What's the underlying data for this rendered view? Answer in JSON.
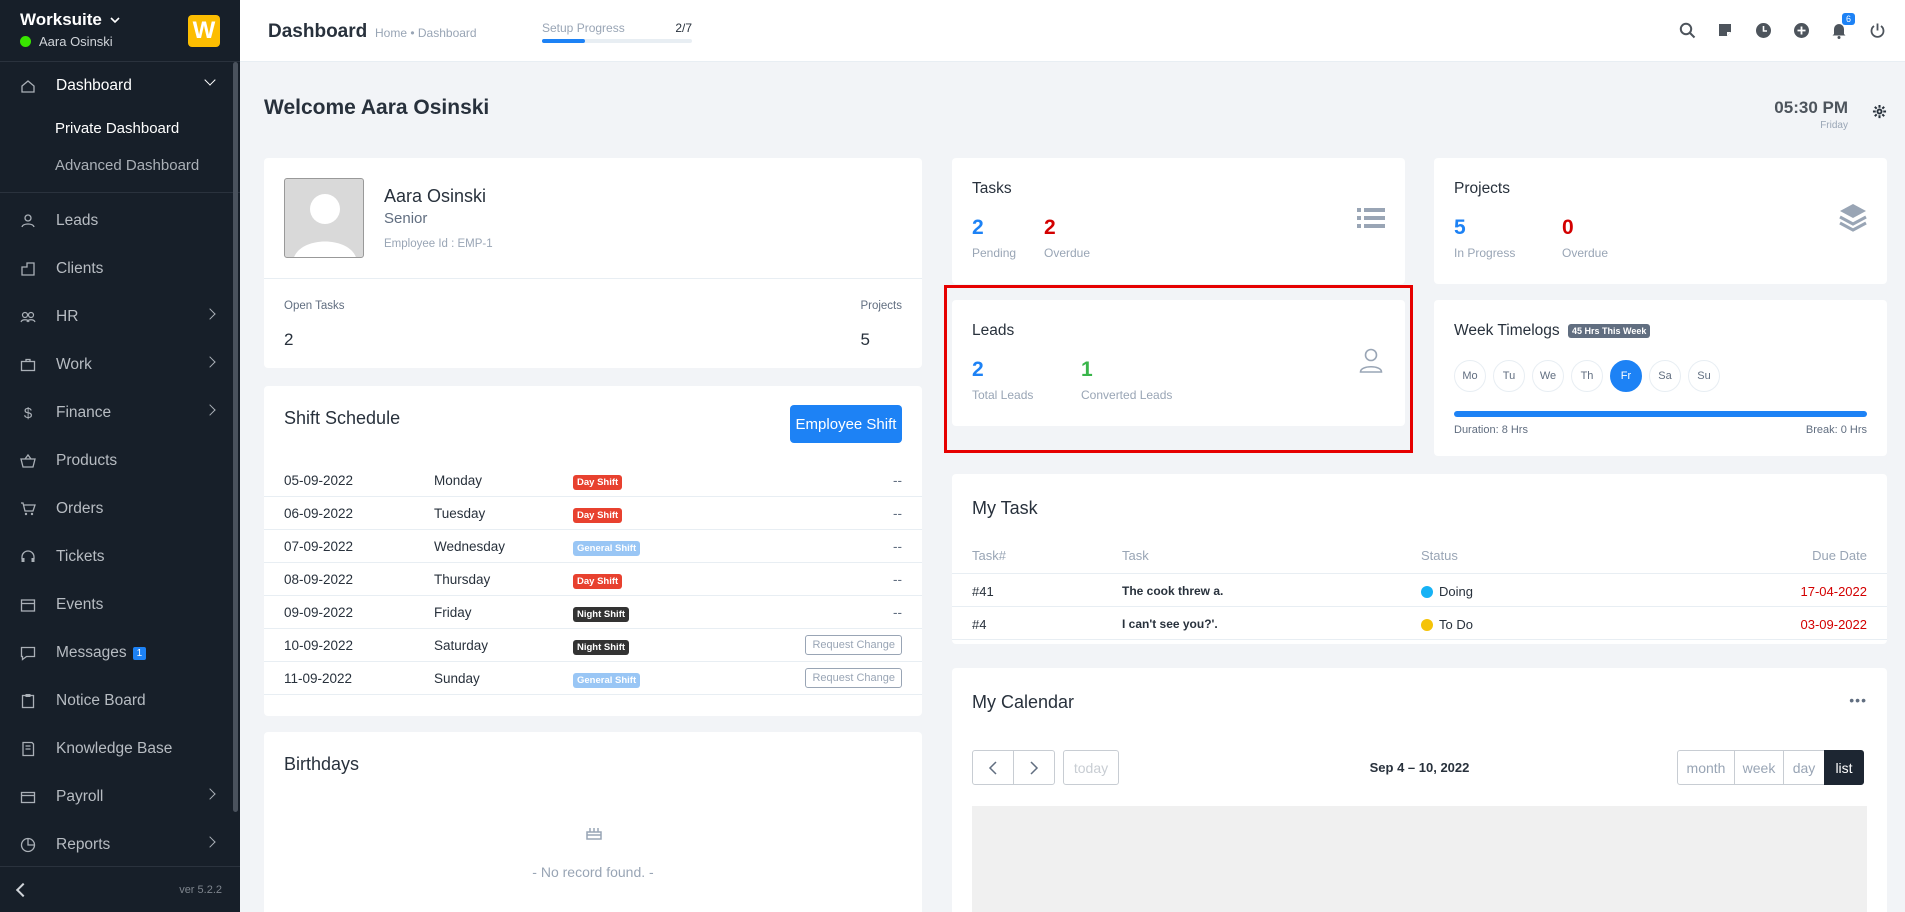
{
  "sidebar": {
    "brand": "Worksuite",
    "user": "Aara Osinski",
    "logo_letter": "W",
    "version": "ver 5.2.2",
    "items": [
      {
        "label": "Dashboard",
        "icon": "home-icon"
      },
      {
        "label": "Private Dashboard"
      },
      {
        "label": "Advanced Dashboard"
      },
      {
        "label": "Leads",
        "icon": "user-icon"
      },
      {
        "label": "Clients",
        "icon": "building-icon"
      },
      {
        "label": "HR",
        "icon": "people-icon"
      },
      {
        "label": "Work",
        "icon": "briefcase-icon"
      },
      {
        "label": "Finance",
        "icon": "dollar-icon"
      },
      {
        "label": "Products",
        "icon": "basket-icon"
      },
      {
        "label": "Orders",
        "icon": "cart-icon"
      },
      {
        "label": "Tickets",
        "icon": "headset-icon"
      },
      {
        "label": "Events",
        "icon": "calendar-icon"
      },
      {
        "label": "Messages",
        "icon": "chat-icon",
        "badge": "1"
      },
      {
        "label": "Notice Board",
        "icon": "clipboard-icon"
      },
      {
        "label": "Knowledge Base",
        "icon": "book-icon"
      },
      {
        "label": "Payroll",
        "icon": "wallet-icon"
      },
      {
        "label": "Reports",
        "icon": "pie-chart-icon"
      }
    ]
  },
  "header": {
    "title": "Dashboard",
    "breadcrumb": "Home • Dashboard",
    "setup_label": "Setup Progress",
    "setup_value": "2/7",
    "setup_fraction": 0.2857,
    "notification_count": "6"
  },
  "main": {
    "welcome": "Welcome Aara Osinski",
    "time": "05:30 PM",
    "day": "Friday",
    "profile": {
      "name": "Aara Osinski",
      "role": "Senior",
      "employee_id": "Employee Id : EMP-1",
      "open_tasks_label": "Open Tasks",
      "open_tasks": "2",
      "projects_label": "Projects",
      "projects": "5"
    },
    "shift": {
      "title": "Shift Schedule",
      "button": "Employee Shift",
      "rows": [
        {
          "date": "05-09-2022",
          "day": "Monday",
          "shift": "Day Shift",
          "color": "#e8412f",
          "action": "--"
        },
        {
          "date": "06-09-2022",
          "day": "Tuesday",
          "shift": "Day Shift",
          "color": "#e8412f",
          "action": "--"
        },
        {
          "date": "07-09-2022",
          "day": "Wednesday",
          "shift": "General Shift",
          "color": "#99c6f5",
          "action": "--"
        },
        {
          "date": "08-09-2022",
          "day": "Thursday",
          "shift": "Day Shift",
          "color": "#e8412f",
          "action": "--"
        },
        {
          "date": "09-09-2022",
          "day": "Friday",
          "shift": "Night Shift",
          "color": "#333333",
          "action": "--"
        },
        {
          "date": "10-09-2022",
          "day": "Saturday",
          "shift": "Night Shift",
          "color": "#333333",
          "action": "Request Change"
        },
        {
          "date": "11-09-2022",
          "day": "Sunday",
          "shift": "General Shift",
          "color": "#99c6f5",
          "action": "Request Change"
        }
      ]
    },
    "birthdays": {
      "title": "Birthdays",
      "empty": "- No record found. -"
    },
    "tasks": {
      "title": "Tasks",
      "pending": "2",
      "pending_label": "Pending",
      "overdue": "2",
      "overdue_label": "Overdue"
    },
    "projects": {
      "title": "Projects",
      "in_progress": "5",
      "in_progress_label": "In Progress",
      "overdue": "0",
      "overdue_label": "Overdue"
    },
    "leads": {
      "title": "Leads",
      "total": "2",
      "total_label": "Total Leads",
      "converted": "1",
      "converted_label": "Converted Leads"
    },
    "timelogs": {
      "title": "Week Timelogs",
      "badge": "45 Hrs This Week",
      "days": [
        "Mo",
        "Tu",
        "We",
        "Th",
        "Fr",
        "Sa",
        "Su"
      ],
      "active_day": 4,
      "duration": "Duration: 8 Hrs",
      "break": "Break: 0 Hrs"
    },
    "my_task": {
      "title": "My Task",
      "headers": [
        "Task#",
        "Task",
        "Status",
        "Due Date"
      ],
      "rows": [
        {
          "id": "#41",
          "task": "The cook threw a.",
          "status": "Doing",
          "status_color": "#16b2f5",
          "due": "17-04-2022"
        },
        {
          "id": "#4",
          "task": "I can't see you?'.",
          "status": "To Do",
          "status_color": "#f5c308",
          "due": "03-09-2022"
        }
      ]
    },
    "calendar": {
      "title": "My Calendar",
      "range": "Sep 4 – 10, 2022",
      "today": "today",
      "views": [
        "month",
        "week",
        "day",
        "list"
      ],
      "active_view": 3
    },
    "colors": {
      "primary": "#1d82f5",
      "danger": "#d30000",
      "success": "#39b54a"
    }
  }
}
